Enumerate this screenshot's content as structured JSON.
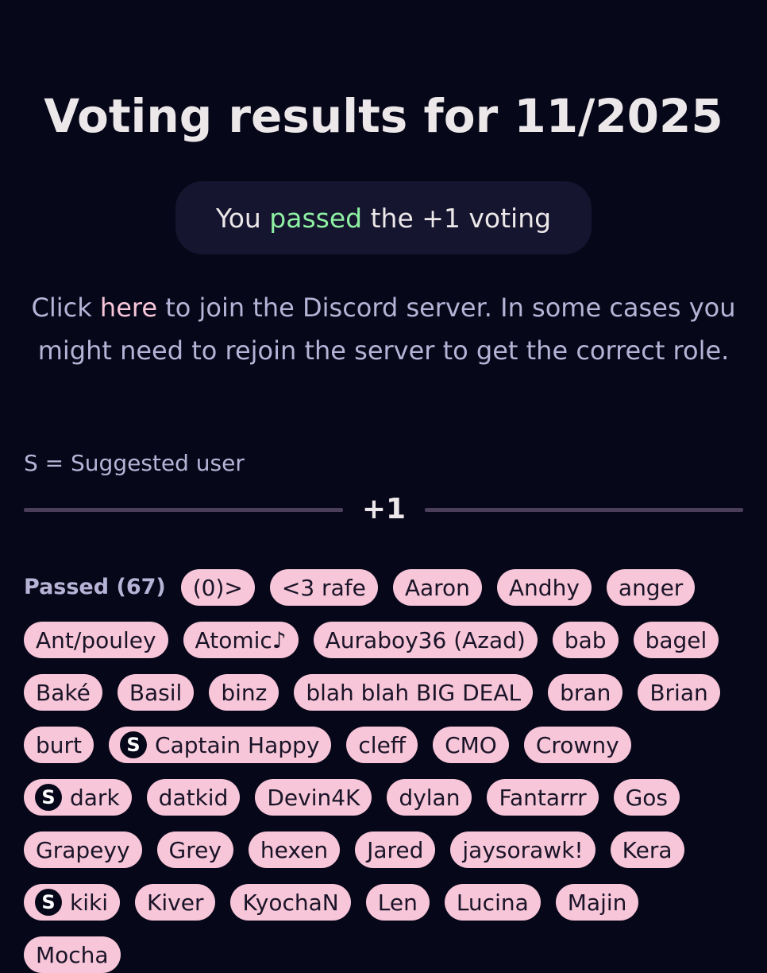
{
  "title": "Voting results for 11/2025",
  "status": {
    "prefix": "You ",
    "result": "passed",
    "suffix": " the +1 voting"
  },
  "discord": {
    "before": "Click ",
    "link": "here",
    "after": " to join the Discord server. In some cases you might need to rejoin the server to get the correct role."
  },
  "legend_note": "S = Suggested user",
  "divider_label": "+1",
  "passed_section": {
    "label": "Passed",
    "count": "(67)",
    "users": [
      {
        "name": "(0)>",
        "suggested": false
      },
      {
        "name": "<3 rafe",
        "suggested": false
      },
      {
        "name": "Aaron",
        "suggested": false
      },
      {
        "name": "Andhy",
        "suggested": false
      },
      {
        "name": "anger",
        "suggested": false
      },
      {
        "name": "Ant/pouley",
        "suggested": false
      },
      {
        "name": "Atomic♪",
        "suggested": false
      },
      {
        "name": "Auraboy36 (Azad)",
        "suggested": false
      },
      {
        "name": "bab",
        "suggested": false
      },
      {
        "name": "bagel",
        "suggested": false
      },
      {
        "name": "Baké",
        "suggested": false
      },
      {
        "name": "Basil",
        "suggested": false
      },
      {
        "name": "binz",
        "suggested": false
      },
      {
        "name": "blah blah BIG DEAL",
        "suggested": false
      },
      {
        "name": "bran",
        "suggested": false
      },
      {
        "name": "Brian",
        "suggested": false
      },
      {
        "name": "burt",
        "suggested": false
      },
      {
        "name": "Captain Happy",
        "suggested": true
      },
      {
        "name": "cleff",
        "suggested": false
      },
      {
        "name": "CMO",
        "suggested": false
      },
      {
        "name": "Crowny",
        "suggested": false
      },
      {
        "name": "dark",
        "suggested": true
      },
      {
        "name": "datkid",
        "suggested": false
      },
      {
        "name": "Devin4K",
        "suggested": false
      },
      {
        "name": "dylan",
        "suggested": false
      },
      {
        "name": "Fantarrr",
        "suggested": false
      },
      {
        "name": "Gos",
        "suggested": false
      },
      {
        "name": "Grapeyy",
        "suggested": false
      },
      {
        "name": "Grey",
        "suggested": false
      },
      {
        "name": "hexen",
        "suggested": false
      },
      {
        "name": "Jared",
        "suggested": false
      },
      {
        "name": "jaysorawk!",
        "suggested": false
      },
      {
        "name": "Kera",
        "suggested": false
      },
      {
        "name": "kiki",
        "suggested": true
      },
      {
        "name": "Kiver",
        "suggested": false
      },
      {
        "name": "KyochaN",
        "suggested": false
      },
      {
        "name": "Len",
        "suggested": false
      },
      {
        "name": "Lucina",
        "suggested": false
      },
      {
        "name": "Majin",
        "suggested": false
      },
      {
        "name": "Mocha",
        "suggested": false
      }
    ],
    "suggested_badge": "S"
  }
}
